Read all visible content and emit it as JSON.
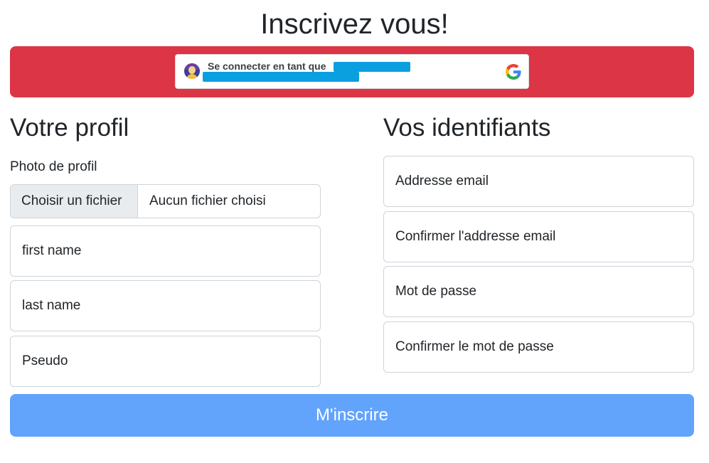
{
  "page": {
    "title": "Inscrivez vous!"
  },
  "google_signin": {
    "text": "Se connecter en tant que",
    "accent_color": "#dc3545"
  },
  "profile": {
    "heading": "Votre profil",
    "photo_label": "Photo de profil",
    "file_button_label": "Choisir un fichier",
    "file_status": "Aucun fichier choisi",
    "fields": [
      {
        "placeholder": "first name"
      },
      {
        "placeholder": "last name"
      },
      {
        "placeholder": "Pseudo"
      }
    ]
  },
  "credentials": {
    "heading": "Vos identifiants",
    "fields": [
      {
        "placeholder": "Addresse email"
      },
      {
        "placeholder": "Confirmer l'addresse email"
      },
      {
        "placeholder": "Mot de passe"
      },
      {
        "placeholder": "Confirmer le mot de passe"
      }
    ]
  },
  "actions": {
    "submit_label": "M'inscrire",
    "submit_color": "#62a3fc"
  }
}
